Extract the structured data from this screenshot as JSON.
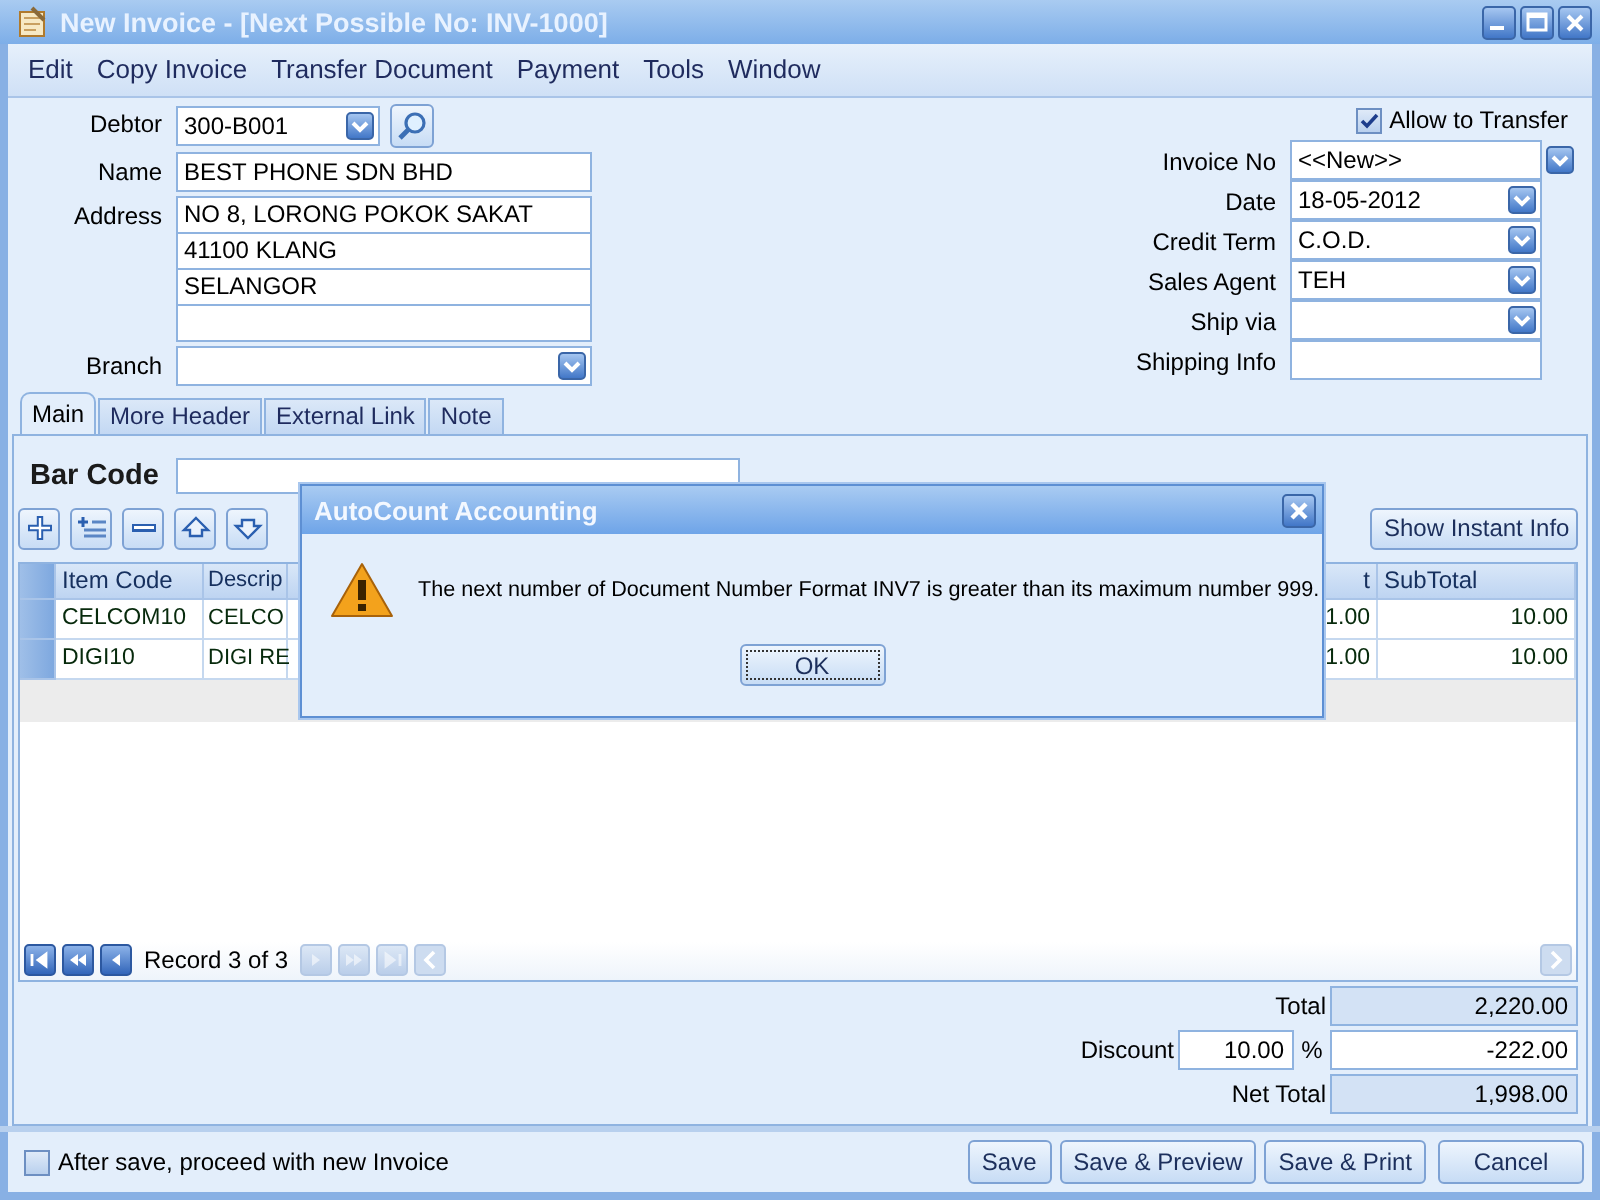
{
  "window": {
    "title": "New Invoice - [Next Possible No: INV-1000]"
  },
  "menu": [
    "Edit",
    "Copy Invoice",
    "Transfer Document",
    "Payment",
    "Tools",
    "Window"
  ],
  "header_left": {
    "debtor": {
      "label": "Debtor",
      "value": "300-B001"
    },
    "name": {
      "label": "Name",
      "value": "BEST PHONE SDN BHD"
    },
    "address": {
      "label": "Address",
      "lines": [
        "NO 8, LORONG POKOK SAKAT",
        "41100 KLANG",
        "SELANGOR"
      ]
    },
    "branch": {
      "label": "Branch"
    }
  },
  "allow_transfer": {
    "label": "Allow to Transfer",
    "checked": true
  },
  "header_right": [
    {
      "label": "Invoice No",
      "value": "<<New>>",
      "kind": "lookup"
    },
    {
      "label": "Date",
      "value": "18-05-2012",
      "kind": "combo"
    },
    {
      "label": "Credit Term",
      "value": "C.O.D.",
      "kind": "combo"
    },
    {
      "label": "Sales Agent",
      "value": "TEH",
      "kind": "combo"
    },
    {
      "label": "Ship via",
      "kind": "combo"
    },
    {
      "label": "Shipping Info",
      "kind": "text"
    }
  ],
  "tabs": [
    {
      "label": "Main",
      "selected": true
    },
    {
      "label": "More Header",
      "selected": false
    },
    {
      "label": "External Link",
      "selected": false
    },
    {
      "label": "Note",
      "selected": false
    }
  ],
  "bar_code": {
    "label": "Bar Code"
  },
  "show_instant_info": "Show Instant Info",
  "grid": {
    "columns": [
      "Item Code",
      "Descrip",
      "t",
      "SubTotal"
    ],
    "rows": [
      [
        "CELCOM10",
        "CELCO",
        "1.00",
        "10.00"
      ],
      [
        "DIGI10",
        "DIGI RE",
        "1.00",
        "10.00"
      ]
    ],
    "record": "Record 3 of 3",
    "navigator": [
      {
        "kind": "first",
        "disabled": false
      },
      {
        "kind": "prev-page",
        "disabled": false
      },
      {
        "kind": "prev",
        "disabled": false
      },
      {
        "kind": "next",
        "disabled": true
      },
      {
        "kind": "next-page",
        "disabled": true
      },
      {
        "kind": "last",
        "disabled": true
      }
    ]
  },
  "totals": {
    "total": {
      "label": "Total",
      "value": "2,220.00"
    },
    "discount": {
      "label": "Discount",
      "rate": "10.00",
      "unit": "%",
      "value": "-222.00"
    },
    "net_total": {
      "label": "Net Total",
      "value": "1,998.00"
    }
  },
  "footer": {
    "proceed_new": {
      "label": "After save, proceed with new Invoice",
      "checked": false
    },
    "buttons": [
      "Save",
      "Save & Preview",
      "Save & Print",
      "Cancel"
    ]
  },
  "dialog": {
    "title": "AutoCount Accounting",
    "message": "The next number of Document Number Format INV7 is greater than its maximum number 999.",
    "buttons": [
      "OK"
    ]
  }
}
